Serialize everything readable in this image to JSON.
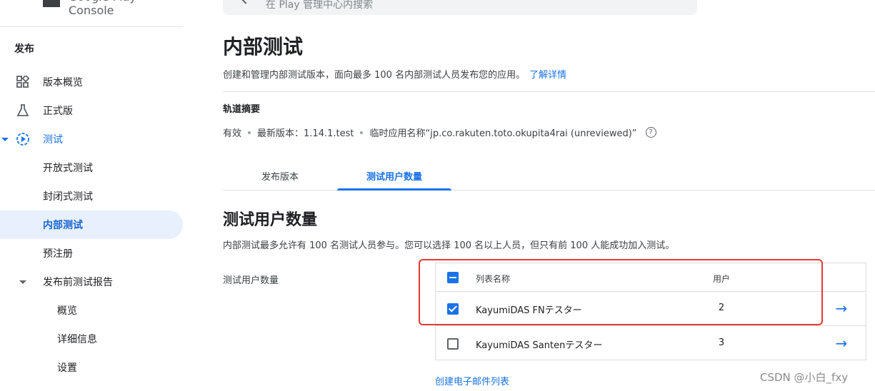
{
  "brand": {
    "text": "Google Play Console"
  },
  "search": {
    "placeholder": "在 Play 管理中心内搜索"
  },
  "sidebar": {
    "section": "发布",
    "items": [
      {
        "label": "版本概览",
        "icon": "dashboard-icon"
      },
      {
        "label": "正式版",
        "icon": "flask-icon"
      },
      {
        "label": "测试",
        "icon": "play-circle-icon"
      },
      {
        "label": "开放式测试"
      },
      {
        "label": "封闭式测试"
      },
      {
        "label": "内部测试"
      },
      {
        "label": "预注册"
      },
      {
        "label": "发布前测试报告"
      },
      {
        "label": "概览"
      },
      {
        "label": "详细信息"
      },
      {
        "label": "设置"
      }
    ]
  },
  "main": {
    "title": "内部测试",
    "description": "创建和管理内部测试版本，面向最多 100 名内部测试人员发布您的应用。",
    "learn_more": "了解详情",
    "track_summary_title": "轨道摘要",
    "track_status": "有效",
    "track_version": "最新版本：1.14.1.test",
    "track_app_name": "临时应用名称“jp.co.rakuten.toto.okupita4rai (unreviewed)”",
    "tabs": [
      {
        "label": "发布版本"
      },
      {
        "label": "测试用户数量"
      }
    ],
    "section_title": "测试用户数量",
    "section_desc": "内部测试最多允许有 100 名测试人员参与。您可以选择 100 名以上人员，但只有前 100 人能成功加入测试。",
    "field_label": "测试用户数量",
    "table": {
      "headers": {
        "name": "列表名称",
        "users": "用户"
      },
      "rows": [
        {
          "name": "KayumiDAS FNテスター",
          "users": "2",
          "checked": true
        },
        {
          "name": "KayumiDAS Santenテスター",
          "users": "3",
          "checked": false
        }
      ]
    },
    "create_link": "创建电子邮件列表"
  },
  "watermark": "CSDN @小白_fxy",
  "colors": {
    "accent": "#1a73e8",
    "highlight": "#e53935",
    "selected_bg": "#e8f0fe"
  }
}
